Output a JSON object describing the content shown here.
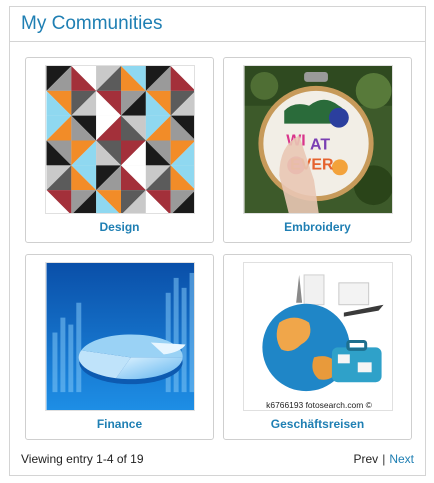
{
  "widget": {
    "title": "My Communities"
  },
  "communities": [
    {
      "name": "Design",
      "image": "geometric-triangles-pattern"
    },
    {
      "name": "Embroidery",
      "image": "embroidery-hoop-photo"
    },
    {
      "name": "Finance",
      "image": "finance-pie-chart-graphic"
    },
    {
      "name": "Geschäftsreisen",
      "image": "globe-suitcase-travel-graphic",
      "watermark": "k6766193 fotosearch.com ©"
    }
  ],
  "footer": {
    "count_text": "Viewing entry 1-4 of 19",
    "prev_label": "Prev",
    "separator": "|",
    "next_label": "Next"
  },
  "colors": {
    "accent": "#1f7fb3",
    "border": "#d4d4d4"
  }
}
